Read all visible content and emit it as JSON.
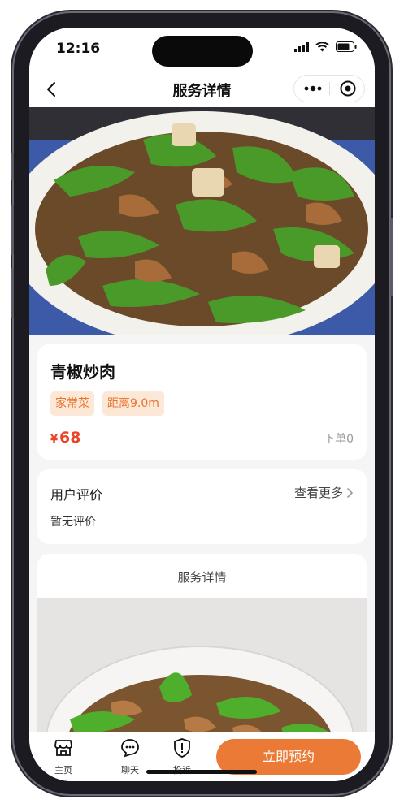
{
  "status_bar": {
    "time": "12:16"
  },
  "nav": {
    "title": "服务详情"
  },
  "dish": {
    "name": "青椒炒肉",
    "tags": [
      "家常菜",
      "距离9.0m"
    ],
    "currency": "¥",
    "price": "68",
    "orders": "下单0"
  },
  "reviews": {
    "title": "用户评价",
    "more": "查看更多",
    "empty": "暂无评价"
  },
  "details": {
    "title": "服务详情"
  },
  "tabbar": {
    "home": "主页",
    "chat": "聊天",
    "complain": "投诉",
    "book": "立即预约"
  },
  "colors": {
    "accent": "#ea7a36",
    "price": "#e8452b",
    "tag_bg": "#fde8d8",
    "tag_text": "#e8722b"
  }
}
